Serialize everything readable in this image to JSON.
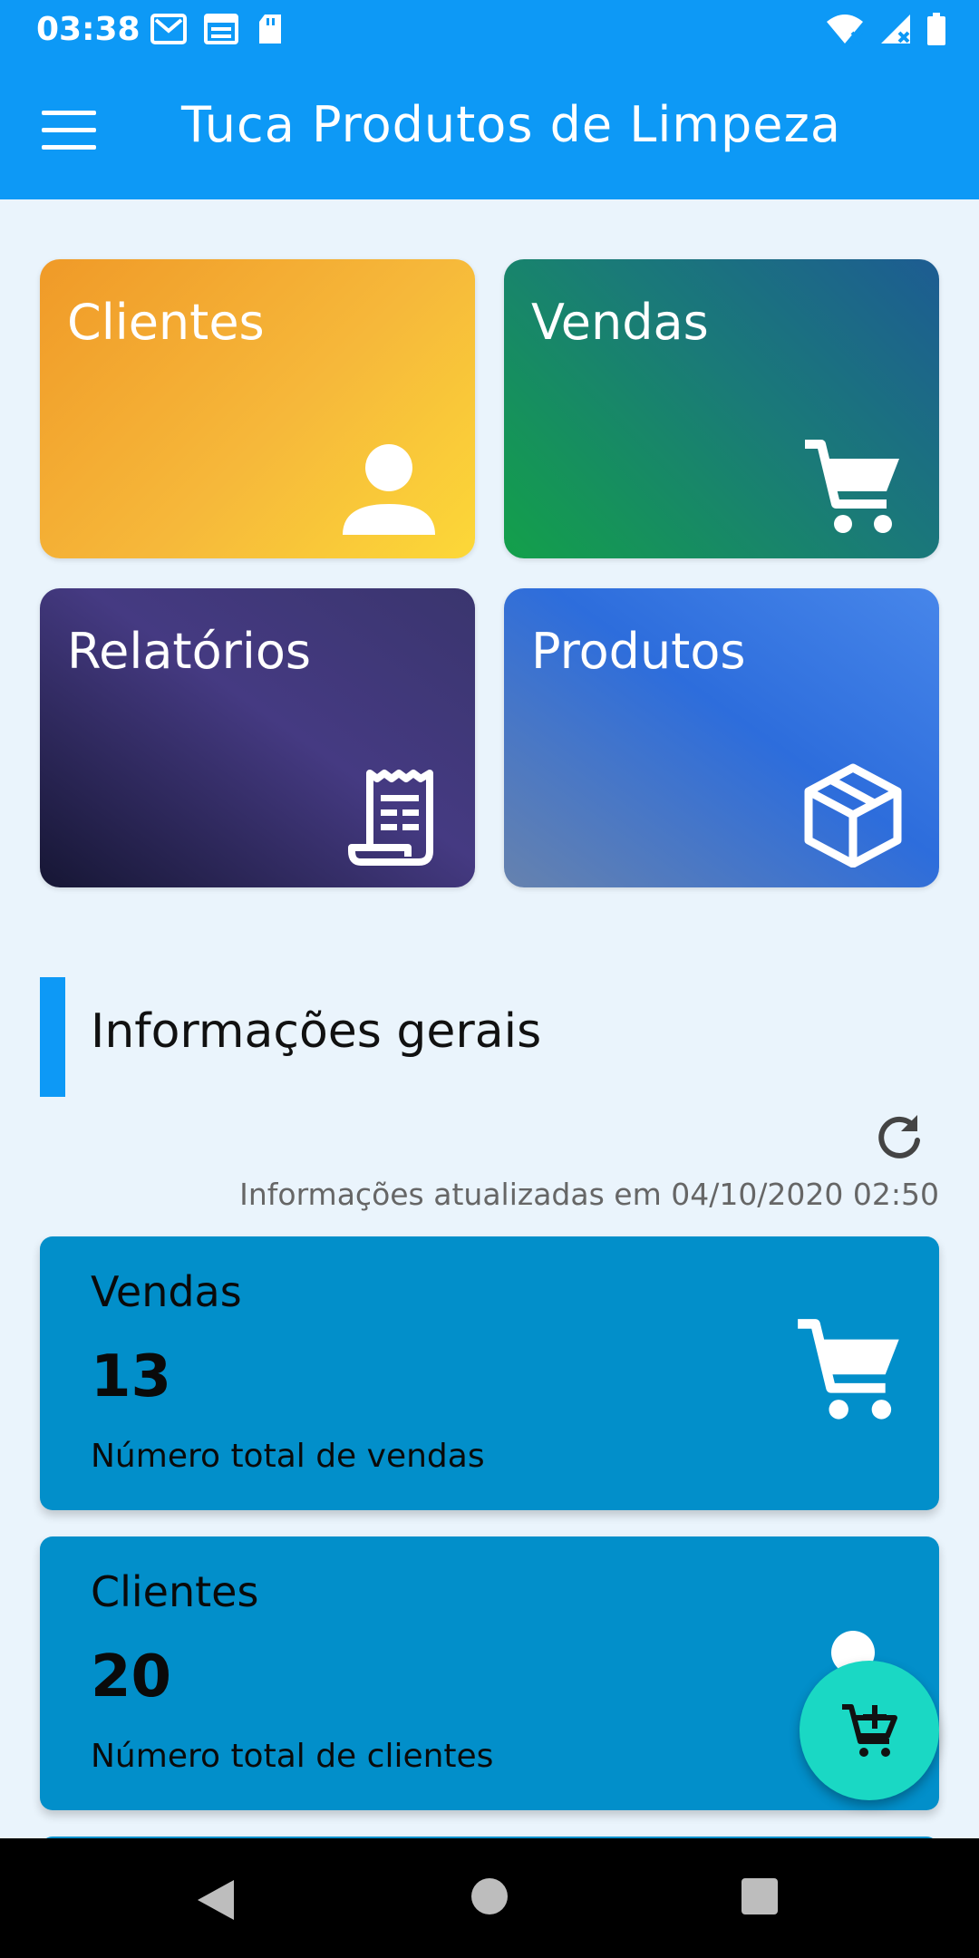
{
  "status_bar": {
    "time": "03:38",
    "left_icons": [
      "gmail-icon",
      "calendar-icon",
      "sd-card-icon"
    ],
    "right_icons": [
      "wifi-icon",
      "signal-icon",
      "battery-icon"
    ]
  },
  "app_bar": {
    "title": "Tuca Produtos de Limpeza",
    "menu_icon": "hamburger-menu-icon",
    "color": "#0d99f6"
  },
  "tiles": [
    {
      "label": "Clientes",
      "icon": "person-icon"
    },
    {
      "label": "Vendas",
      "icon": "cart-icon"
    },
    {
      "label": "Relatórios",
      "icon": "receipt-icon"
    },
    {
      "label": "Produtos",
      "icon": "box-icon"
    }
  ],
  "section": {
    "title": "Informações gerais",
    "refresh_icon": "refresh-icon",
    "updated_text": "Informações atualizadas em 04/10/2020 02:50"
  },
  "cards": [
    {
      "title": "Vendas",
      "value": "13",
      "description": "Número total de vendas",
      "icon": "cart-icon"
    },
    {
      "title": "Clientes",
      "value": "20",
      "description": "Número total de clientes",
      "icon": "person-icon"
    }
  ],
  "fab": {
    "icon": "add-to-cart-icon",
    "color": "#1ad8c4"
  },
  "nav_bar": {
    "buttons": [
      "back-icon",
      "home-icon",
      "recents-icon"
    ]
  }
}
